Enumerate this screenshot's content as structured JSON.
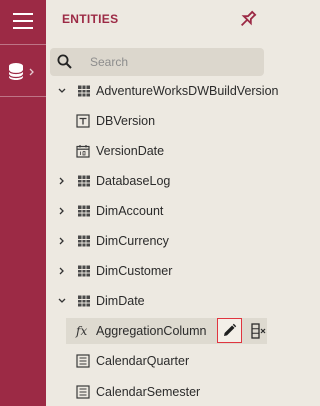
{
  "panel": {
    "title": "ENTITIES"
  },
  "search": {
    "placeholder": "Search"
  },
  "tree": {
    "items": [
      {
        "label": "AdventureWorksDWBuildVersion",
        "kind": "table",
        "expanded": true
      },
      {
        "label": "DBVersion",
        "kind": "field-text"
      },
      {
        "label": "VersionDate",
        "kind": "field-date"
      },
      {
        "label": "DatabaseLog",
        "kind": "table",
        "expanded": false
      },
      {
        "label": "DimAccount",
        "kind": "table",
        "expanded": false
      },
      {
        "label": "DimCurrency",
        "kind": "table",
        "expanded": false
      },
      {
        "label": "DimCustomer",
        "kind": "table",
        "expanded": false
      },
      {
        "label": "DimDate",
        "kind": "table",
        "expanded": true
      },
      {
        "label": "AggregationColumn",
        "kind": "calculated",
        "selected": true
      },
      {
        "label": "CalendarQuarter",
        "kind": "field-number"
      },
      {
        "label": "CalendarSemester",
        "kind": "field-number"
      }
    ]
  },
  "icons": {
    "menu": "hamburger-menu-icon",
    "database": "database-icon",
    "pin": "pin-icon",
    "search": "search-icon",
    "edit": "pencil-icon",
    "more": "column-delete-icon",
    "calculated": "fx"
  },
  "colors": {
    "accent": "#9c2a45",
    "highlight": "#e0353f",
    "background": "#ede9e1"
  }
}
